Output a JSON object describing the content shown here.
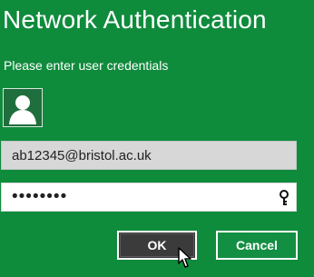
{
  "dialog": {
    "title": "Network Authentication",
    "subtitle": "Please enter user credentials",
    "avatar_icon": "user-avatar-icon",
    "username_value": "ab12345@bristol.ac.uk",
    "password_masked": "••••••••",
    "password_reveal_icon": "key-icon",
    "ok_label": "OK",
    "cancel_label": "Cancel"
  },
  "colors": {
    "background": "#0f8b3c",
    "username_field": "#d7d7d7",
    "ok_button": "#3b3b3b",
    "cancel_button": "#138f43",
    "text": "#ffffff"
  }
}
